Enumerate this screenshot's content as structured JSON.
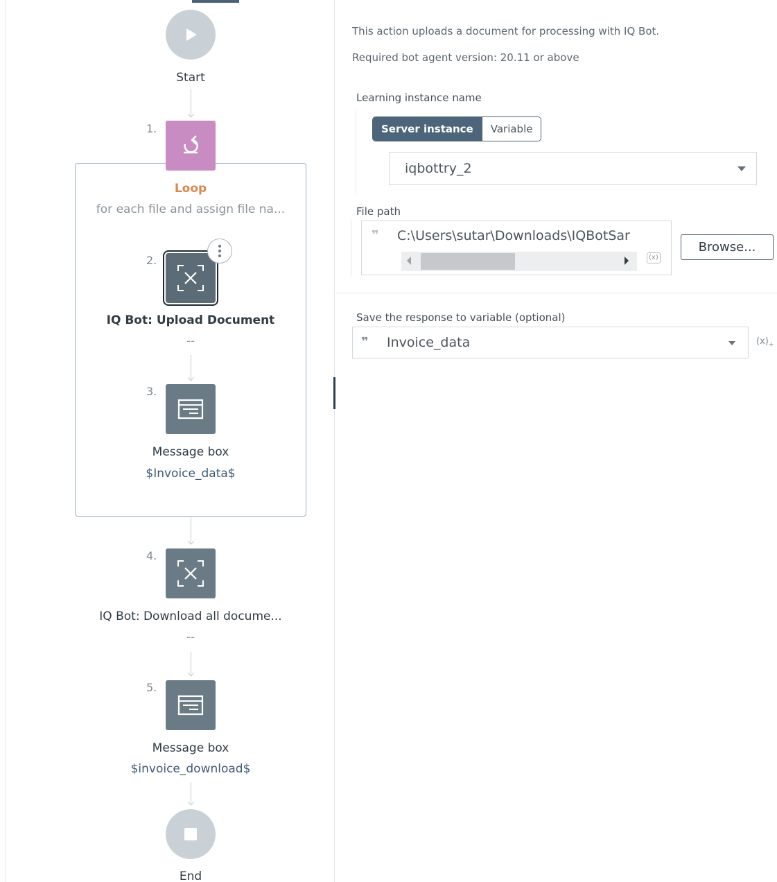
{
  "flow": {
    "start_label": "Start",
    "end_label": "End",
    "steps": [
      {
        "num": "1.",
        "title": "Loop",
        "subtitle": "for each file and assign file na...",
        "icon": "loop-icon"
      },
      {
        "num": "2.",
        "title": "IQ Bot: Upload Document",
        "subtitle": "--",
        "icon": "iqbot-icon"
      },
      {
        "num": "3.",
        "title": "Message box",
        "subtitle": "$Invoice_data$",
        "icon": "message-box-icon"
      },
      {
        "num": "4.",
        "title": "IQ Bot: Download all docume...",
        "subtitle": "--",
        "icon": "iqbot-icon"
      },
      {
        "num": "5.",
        "title": "Message box",
        "subtitle": "$invoice_download$",
        "icon": "message-box-icon"
      }
    ]
  },
  "panel": {
    "description": "This action uploads a document for processing with IQ Bot.",
    "agent_version": "Required bot agent version: 20.11 or above",
    "learning_instance": {
      "label": "Learning instance name",
      "toggle": [
        "Server instance",
        "Variable"
      ],
      "selected_toggle": "Server instance",
      "value": "iqbottry_2"
    },
    "file_path": {
      "label": "File path",
      "value": "C:\\Users\\sutar\\Downloads\\IQBotSar",
      "browse_label": "Browse..."
    },
    "response": {
      "label": "Save the response to variable (optional)",
      "value": "Invoice_data"
    }
  },
  "colors": {
    "loop_accent": "#c98cc2",
    "loop_title": "#d9894f",
    "node_gray": "#6b7b86",
    "variable_blue": "#3d5a78",
    "toggle_active": "#4d657a"
  }
}
